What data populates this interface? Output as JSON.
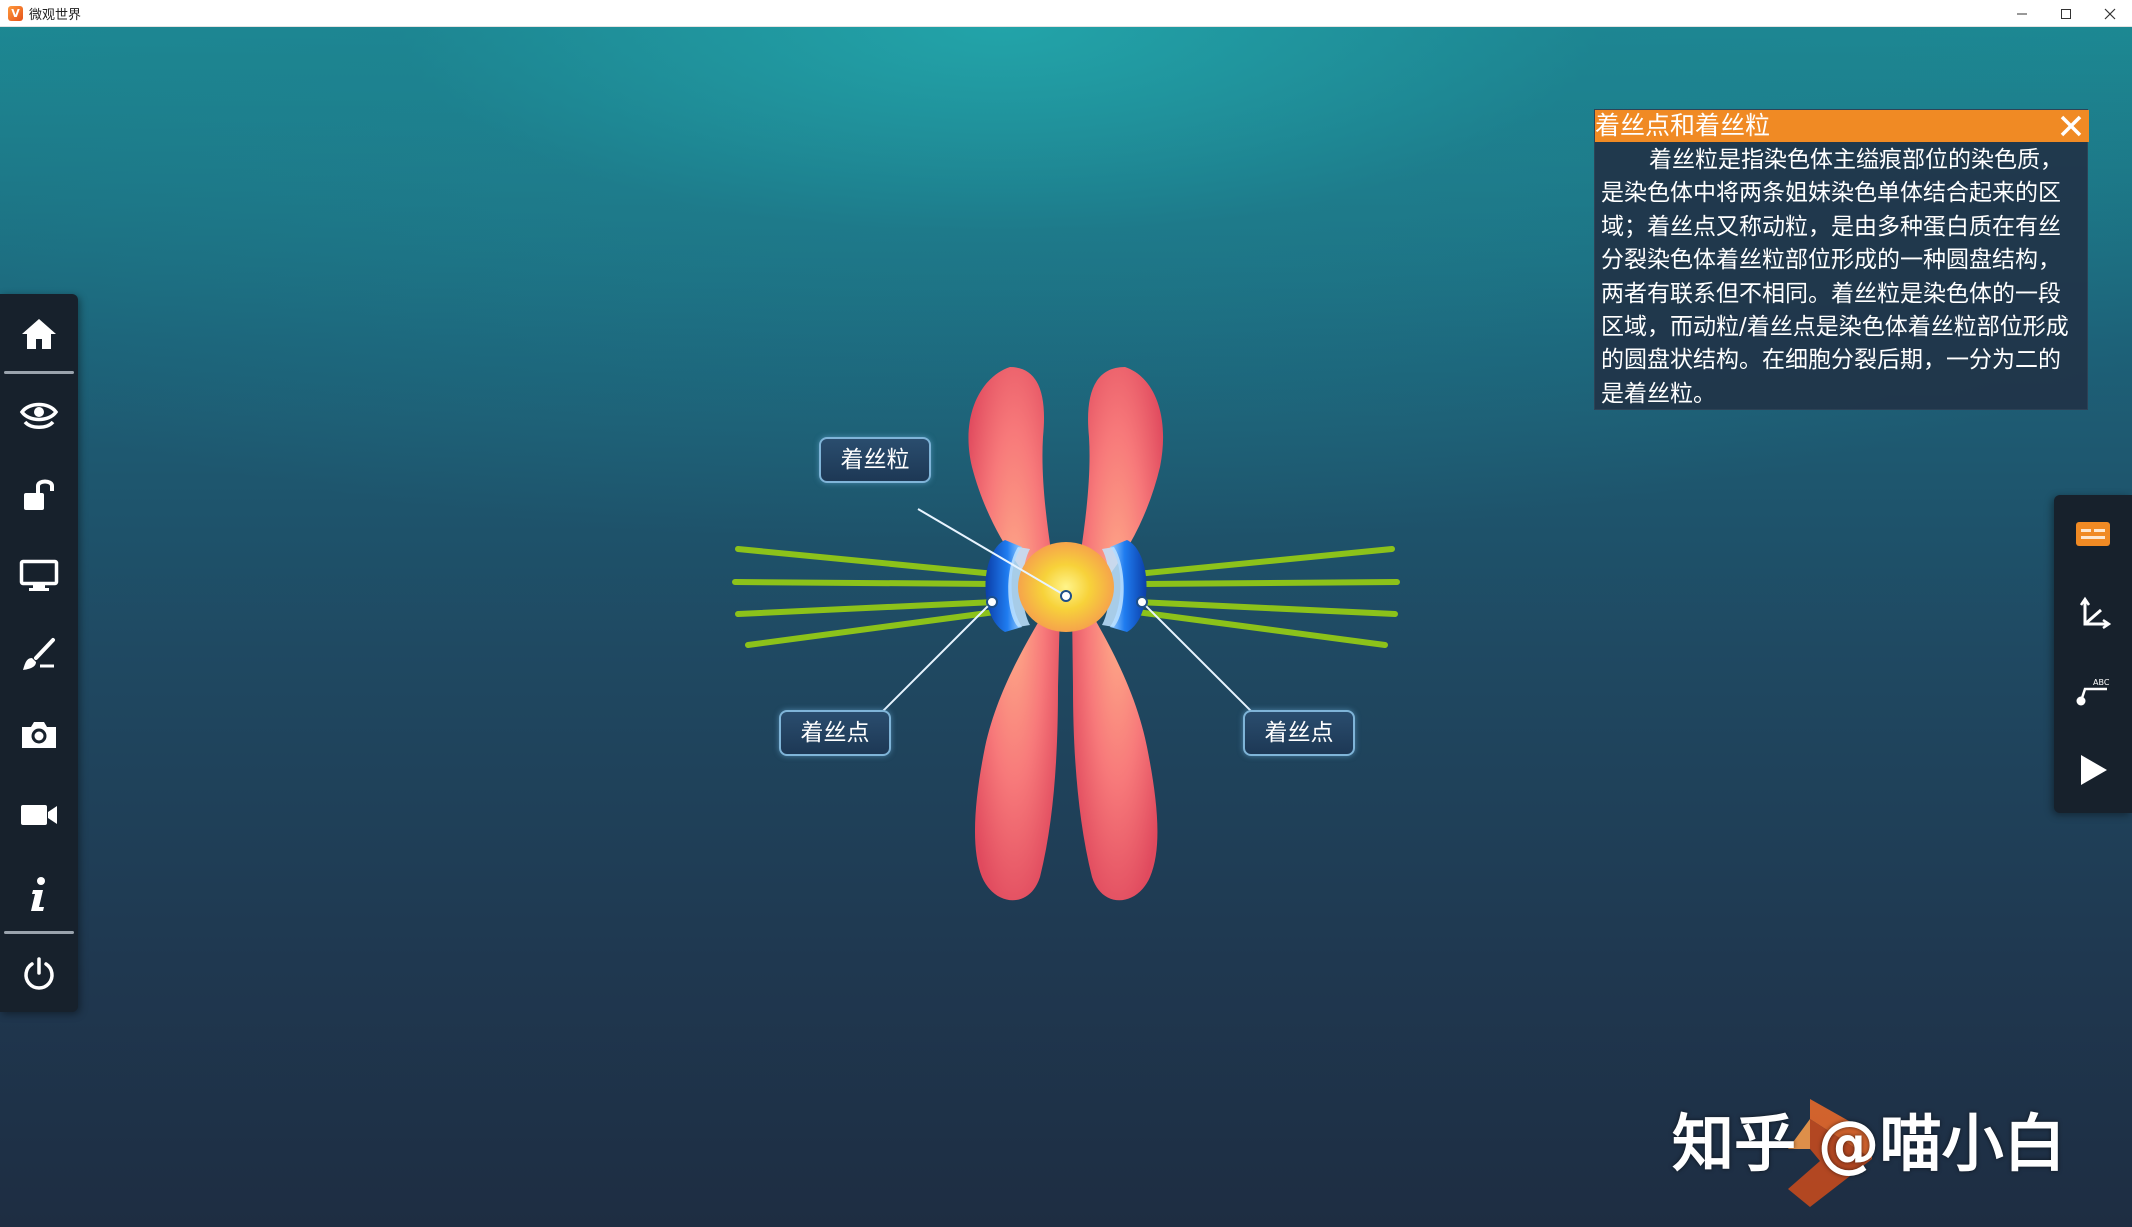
{
  "window": {
    "title": "微观世界",
    "icon_letter": "V",
    "controls": [
      "minimize",
      "maximize",
      "close"
    ]
  },
  "left_toolbar": {
    "items": [
      {
        "name": "home",
        "icon": "home-icon"
      },
      {
        "name": "view",
        "icon": "eye-icon"
      },
      {
        "name": "lock",
        "icon": "unlock-icon"
      },
      {
        "name": "display",
        "icon": "monitor-icon"
      },
      {
        "name": "draw",
        "icon": "brush-icon"
      },
      {
        "name": "screenshot",
        "icon": "camera-icon"
      },
      {
        "name": "record",
        "icon": "video-icon"
      },
      {
        "name": "info",
        "icon": "info-icon"
      },
      {
        "name": "power",
        "icon": "power-icon"
      }
    ]
  },
  "right_toolbar": {
    "items": [
      {
        "name": "subtitles",
        "icon": "caption-icon",
        "active_color": "#f08a24"
      },
      {
        "name": "axes",
        "icon": "axis-icon"
      },
      {
        "name": "labels",
        "icon": "label-pin-icon"
      },
      {
        "name": "play",
        "icon": "play-icon"
      }
    ]
  },
  "info_panel": {
    "title": "着丝点和着丝粒",
    "body": "着丝粒是指染色体主缢痕部位的染色质，是染色体中将两条姐妹染色单体结合起来的区域；着丝点又称动粒，是由多种蛋白质在有丝分裂染色体着丝粒部位形成的一种圆盘结构，两者有联系但不相同。着丝粒是染色体的一段区域，而动粒/着丝点是染色体着丝粒部位形成的圆盘状结构。在细胞分裂后期，一分为二的是着丝粒。",
    "header_color": "#f08a24"
  },
  "model": {
    "labels": {
      "centromere": "着丝粒",
      "kinetochore_left": "着丝点",
      "kinetochore_right": "着丝点"
    },
    "colors": {
      "chromatid": "#f2777a",
      "centromere": "#f7d23a",
      "kinetochore": "#1d6de0",
      "spindle": "#8cc21a"
    }
  },
  "watermark": {
    "text": "知乎 @喵小白"
  }
}
